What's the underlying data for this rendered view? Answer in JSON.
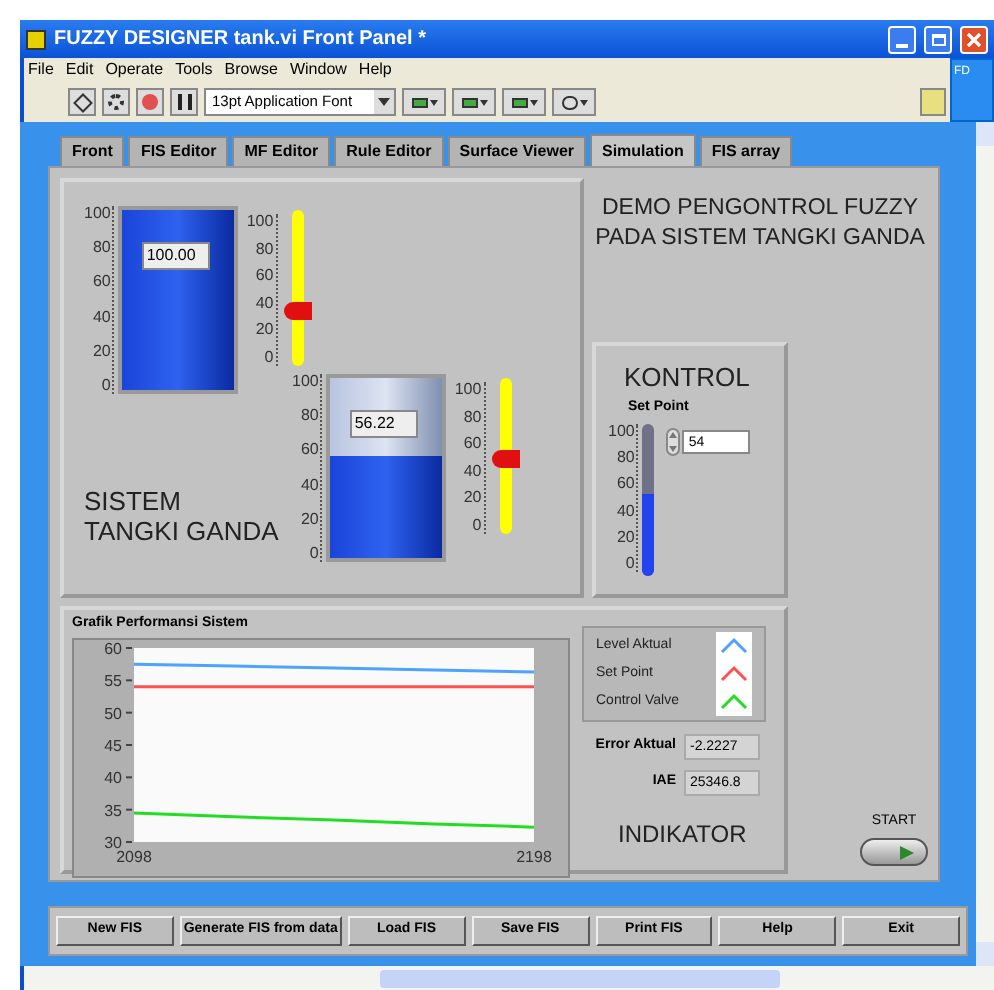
{
  "window": {
    "title": "FUZZY DESIGNER tank.vi Front Panel *"
  },
  "menu": [
    "File",
    "Edit",
    "Operate",
    "Tools",
    "Browse",
    "Window",
    "Help"
  ],
  "toolbar": {
    "font": "13pt Application Font",
    "badge": "FD"
  },
  "tabs": [
    {
      "label": "Front",
      "selected": false
    },
    {
      "label": "FIS Editor",
      "selected": false
    },
    {
      "label": "MF Editor",
      "selected": false
    },
    {
      "label": "Rule Editor",
      "selected": false
    },
    {
      "label": "Surface Viewer",
      "selected": false
    },
    {
      "label": "Simulation",
      "selected": true
    },
    {
      "label": "FIS array",
      "selected": false
    }
  ],
  "system": {
    "title_lines": [
      "SISTEM",
      "TANGKI GANDA"
    ],
    "tanks": [
      {
        "scale": [
          "100",
          "80",
          "60",
          "40",
          "20",
          "0"
        ],
        "level": 1.0,
        "reading": "100.00",
        "valve": {
          "scale": [
            "100",
            "80",
            "60",
            "40",
            "20",
            "0"
          ],
          "level": 0.35
        }
      },
      {
        "scale": [
          "100",
          "80",
          "60",
          "40",
          "20",
          "0"
        ],
        "level": 0.5622,
        "reading": "56.22",
        "valve": {
          "scale": [
            "100",
            "80",
            "60",
            "40",
            "20",
            "0"
          ],
          "level": 0.48
        }
      }
    ]
  },
  "heading_lines": [
    "DEMO PENGONTROL FUZZY",
    "PADA SISTEM TANGKI GANDA"
  ],
  "control": {
    "title": "KONTROL",
    "label": "Set Point",
    "scale": [
      "100",
      "80",
      "60",
      "40",
      "20",
      "0"
    ],
    "level": 0.54,
    "value": "54"
  },
  "chart": {
    "title": "Grafik Performansi Sistem",
    "chart_data": {
      "type": "line",
      "x": [
        2098,
        2123,
        2148,
        2173,
        2198
      ],
      "xlim": [
        2098,
        2198
      ],
      "ylim": [
        30,
        60
      ],
      "xticks": [
        2098,
        2198
      ],
      "yticks": [
        30,
        35,
        40,
        45,
        50,
        55,
        60
      ],
      "series": [
        {
          "name": "Level Aktual",
          "color": "#4da3ff",
          "values": [
            57.5,
            57.2,
            56.9,
            56.6,
            56.3
          ]
        },
        {
          "name": "Set Point",
          "color": "#ff5050",
          "values": [
            54,
            54,
            54,
            54,
            54
          ]
        },
        {
          "name": "Control Valve",
          "color": "#22dd22",
          "values": [
            34.5,
            33.9,
            33.4,
            32.8,
            32.3
          ]
        }
      ]
    }
  },
  "indicators": [
    {
      "label": "Error Aktual",
      "value": "-2.2227"
    },
    {
      "label": "IAE",
      "value": "25346.8"
    }
  ],
  "indicator_title": "INDIKATOR",
  "start": {
    "label": "START"
  },
  "buttons": [
    "New FIS",
    "Generate FIS from data",
    "Load FIS",
    "Save FIS",
    "Print FIS",
    "Help",
    "Exit"
  ]
}
